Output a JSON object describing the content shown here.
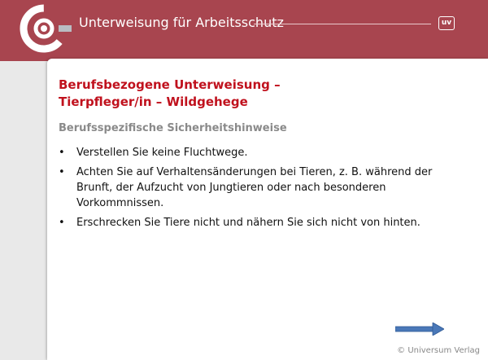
{
  "header": {
    "title": "Unterweisung für Arbeitsschutz",
    "badge": "uv",
    "color": "#a8454f"
  },
  "slide": {
    "title_line1": "Berufsbezogene Unterweisung –",
    "title_line2": "Tierpfleger/in – Wildgehege",
    "subtitle": "Berufsspezifische Sicherheitshinweise",
    "bullets": [
      "Verstellen Sie keine Fluchtwege.",
      "Achten Sie auf Verhaltensänderungen bei Tieren, z. B. während der Brunft, der Aufzucht von Jungtieren oder nach besonderen Vorkommnissen.",
      "Erschrecken Sie Tiere nicht und nähern Sie sich nicht von hinten."
    ]
  },
  "footer": {
    "copyright": "© Universum Verlag",
    "next_icon": "arrow-right-icon"
  },
  "colors": {
    "title": "#c0111d",
    "subtitle": "#8a8a8a",
    "arrow": "#4a78b8"
  }
}
